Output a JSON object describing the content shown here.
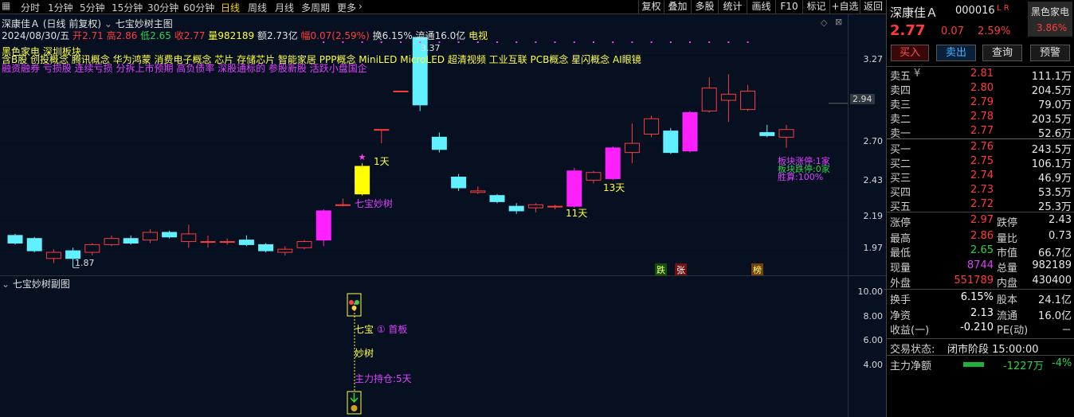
{
  "toolbar": {
    "periods": [
      "分时",
      "1分钟",
      "5分钟",
      "15分钟",
      "30分钟",
      "60分钟",
      "日线",
      "周线",
      "月线",
      "多周期",
      "更多"
    ],
    "active_period": "日线",
    "right_buttons": [
      "复权",
      "叠加",
      "多股",
      "统计",
      "画线",
      "F10",
      "标记",
      "+自选",
      "返回"
    ]
  },
  "header": {
    "stock_name": "深康佳Ａ",
    "period_mode": "(日线 前复权)",
    "indicator_main": "七宝妙树主图",
    "date": "2024/08/30/五",
    "open_label": "开",
    "open": "2.71",
    "high_label": "高",
    "high": "2.86",
    "low_label": "低",
    "low": "2.65",
    "close_label": "收",
    "close": "2.77",
    "vol_label": "量",
    "vol": "982189",
    "amount_label": "额",
    "amount": "2.73亿",
    "change_label": "幅",
    "change": "0.07(2.59%)",
    "turnover_label": "换",
    "turnover": "6.15%",
    "float_label": "流通",
    "float": "16.0亿",
    "tv_label": "电视"
  },
  "info_lines": {
    "line1": "黑色家电 深圳板块",
    "line2": "含B股 创投概念 腾讯概念 华为鸿蒙 消费电子概念 芯片 存储芯片 智能家居 PPP概念 MiniLED MicroLED 超清视频 工业互联 PCB概念 星闪概念 AI眼镜",
    "line3": "融资融券 亏损股 连续亏损 分拆上市预期 高负债率 深股通标的 参股新股 活跃小盘国企"
  },
  "main_axis": {
    "ticks": [
      "3.27",
      "2.94",
      "2.70",
      "2.43",
      "2.19",
      "1.97"
    ],
    "highlight": "2.94"
  },
  "annotations": {
    "high_mark": "3.37",
    "low_mark": "1.87",
    "signal": "七宝妙树",
    "day1": "1天",
    "day11": "11天",
    "day13": "13天",
    "sector_up": "板块涨停:1家",
    "sector_down": "板块跌停:0家",
    "win_rate": "胜算:100%",
    "tag_die": "跌",
    "tag_zhang": "张",
    "tag_bang": "榜"
  },
  "chart_data": {
    "type": "candlestick",
    "candles": [
      {
        "o": 2.08,
        "c": 2.03,
        "h": 2.09,
        "l": 2.02
      },
      {
        "o": 2.06,
        "c": 1.98,
        "h": 2.07,
        "l": 1.97
      },
      {
        "o": 1.93,
        "c": 1.97,
        "h": 1.99,
        "l": 1.9
      },
      {
        "o": 1.98,
        "c": 1.93,
        "h": 2.0,
        "l": 1.87
      },
      {
        "o": 1.97,
        "c": 2.02,
        "h": 2.03,
        "l": 1.95
      },
      {
        "o": 2.02,
        "c": 2.06,
        "h": 2.08,
        "l": 2.01
      },
      {
        "o": 2.06,
        "c": 2.03,
        "h": 2.08,
        "l": 2.02
      },
      {
        "o": 2.05,
        "c": 2.1,
        "h": 2.12,
        "l": 2.03
      },
      {
        "o": 2.1,
        "c": 2.07,
        "h": 2.11,
        "l": 2.06
      },
      {
        "o": 2.04,
        "c": 2.09,
        "h": 2.15,
        "l": 2.0
      },
      {
        "o": 2.04,
        "c": 2.04,
        "h": 2.08,
        "l": 2.0
      },
      {
        "o": 2.04,
        "c": 2.04,
        "h": 2.06,
        "l": 2.02
      },
      {
        "o": 2.05,
        "c": 2.02,
        "h": 2.08,
        "l": 2.01
      },
      {
        "o": 2.02,
        "c": 1.98,
        "h": 2.03,
        "l": 1.97
      },
      {
        "o": 1.97,
        "c": 1.99,
        "h": 2.01,
        "l": 1.95
      },
      {
        "o": 2.0,
        "c": 2.04,
        "h": 2.05,
        "l": 1.99
      },
      {
        "o": 2.05,
        "c": 2.24,
        "h": 2.25,
        "l": 2.01
      },
      {
        "o": 2.28,
        "c": 2.28,
        "h": 2.32,
        "l": 2.27
      },
      {
        "o": 2.35,
        "c": 2.53,
        "h": 2.55,
        "l": 2.34
      },
      {
        "o": 2.77,
        "c": 2.77,
        "h": 2.77,
        "l": 2.68
      },
      {
        "o": 3.02,
        "c": 3.02,
        "h": 3.02,
        "l": 3.02
      },
      {
        "o": 3.37,
        "c": 2.93,
        "h": 3.37,
        "l": 2.89
      },
      {
        "o": 2.72,
        "c": 2.64,
        "h": 2.75,
        "l": 2.62
      },
      {
        "o": 2.46,
        "c": 2.39,
        "h": 2.48,
        "l": 2.37
      },
      {
        "o": 2.36,
        "c": 2.37,
        "h": 2.4,
        "l": 2.35
      },
      {
        "o": 2.34,
        "c": 2.3,
        "h": 2.35,
        "l": 2.29
      },
      {
        "o": 2.27,
        "c": 2.24,
        "h": 2.29,
        "l": 2.22
      },
      {
        "o": 2.26,
        "c": 2.28,
        "h": 2.29,
        "l": 2.23
      },
      {
        "o": 2.27,
        "c": 2.27,
        "h": 2.28,
        "l": 2.25
      },
      {
        "o": 2.27,
        "c": 2.5,
        "h": 2.52,
        "l": 2.26
      },
      {
        "o": 2.44,
        "c": 2.49,
        "h": 2.5,
        "l": 2.42
      },
      {
        "o": 2.45,
        "c": 2.65,
        "h": 2.66,
        "l": 2.44
      },
      {
        "o": 2.62,
        "c": 2.68,
        "h": 2.81,
        "l": 2.55
      },
      {
        "o": 2.74,
        "c": 2.84,
        "h": 2.86,
        "l": 2.72
      },
      {
        "o": 2.76,
        "c": 2.62,
        "h": 2.78,
        "l": 2.61
      },
      {
        "o": 2.63,
        "c": 2.88,
        "h": 2.89,
        "l": 2.62
      },
      {
        "o": 2.89,
        "c": 3.04,
        "h": 3.11,
        "l": 2.88
      },
      {
        "o": 2.96,
        "c": 3.0,
        "h": 3.13,
        "l": 2.82
      },
      {
        "o": 2.9,
        "c": 3.02,
        "h": 3.06,
        "l": 2.89
      },
      {
        "o": 2.75,
        "c": 2.73,
        "h": 2.8,
        "l": 2.72
      },
      {
        "o": 2.72,
        "c": 2.77,
        "h": 2.8,
        "l": 2.65
      }
    ],
    "ylim": [
      1.82,
      3.52
    ]
  },
  "sub_chart": {
    "title": "七宝妙树副图",
    "ticks": [
      "10.00",
      "8.00",
      "6.00",
      "4.00"
    ],
    "label_qibao": "七宝",
    "label_first": "① 首板",
    "label_miaoshu": "妙树",
    "label_hold": "主力持仓:5天"
  },
  "panel": {
    "name": "深康佳Ａ",
    "code": "000016",
    "flags": "L R",
    "sector": "黑色家电",
    "sector_pct": "3.86%",
    "price": "2.77",
    "chg": "0.07",
    "chg_pct": "2.59%",
    "buttons": [
      "买入",
      "卖出",
      "查询",
      "预警"
    ],
    "asks": [
      {
        "label": "卖五",
        "price": "2.81",
        "vol": "111.1万",
        "mark": "¥"
      },
      {
        "label": "卖四",
        "price": "2.80",
        "vol": "204.5万",
        "mark": ""
      },
      {
        "label": "卖三",
        "price": "2.79",
        "vol": "79.0万",
        "mark": ""
      },
      {
        "label": "卖二",
        "price": "2.78",
        "vol": "203.5万",
        "mark": ""
      },
      {
        "label": "卖一",
        "price": "2.77",
        "vol": "52.6万",
        "mark": ""
      }
    ],
    "bids": [
      {
        "label": "买一",
        "price": "2.76",
        "vol": "243.5万"
      },
      {
        "label": "买二",
        "price": "2.75",
        "vol": "106.1万"
      },
      {
        "label": "买三",
        "price": "2.74",
        "vol": "46.9万"
      },
      {
        "label": "买四",
        "price": "2.73",
        "vol": "53.5万"
      },
      {
        "label": "买五",
        "price": "2.72",
        "vol": "25.3万"
      }
    ],
    "stats": {
      "zhangting_l": "涨停",
      "zhangting": "2.97",
      "dieting_l": "跌停",
      "dieting": "2.43",
      "zuigao_l": "最高",
      "zuigao": "2.86",
      "liangbi_l": "量比",
      "liangbi": "0.73",
      "zuidi_l": "最低",
      "zuidi": "2.65",
      "shizhi_l": "市值",
      "shizhi": "66.7亿",
      "xianliang_l": "现量",
      "xianliang": "8744",
      "zongliang_l": "总量",
      "zongliang": "982189",
      "waipan_l": "外盘",
      "waipan": "551789",
      "neipan_l": "内盘",
      "neipan": "430400",
      "huanshou_l": "换手",
      "huanshou": "6.15%",
      "guben_l": "股本",
      "guben": "24.1亿",
      "jingzi_l": "净资",
      "jingzi": "2.13",
      "liutong_l": "流通",
      "liutong": "16.0亿",
      "shouyi_l": "收益(一)",
      "shouyi": "-0.210",
      "pe_l": "PE(动)",
      "pe": "－"
    },
    "trade_state_l": "交易状态:",
    "trade_state": "闭市阶段 15:00:00",
    "net_inflow_l": "主力净额",
    "net_inflow": "-1227万",
    "net_pct": "-4%"
  }
}
